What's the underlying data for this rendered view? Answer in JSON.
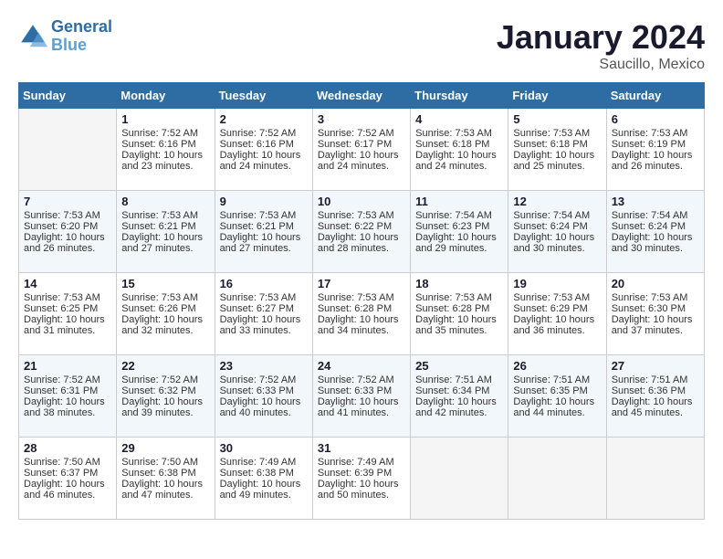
{
  "header": {
    "logo_line1": "General",
    "logo_line2": "Blue",
    "month": "January 2024",
    "location": "Saucillo, Mexico"
  },
  "days_of_week": [
    "Sunday",
    "Monday",
    "Tuesday",
    "Wednesday",
    "Thursday",
    "Friday",
    "Saturday"
  ],
  "weeks": [
    [
      {
        "day": "",
        "empty": true
      },
      {
        "day": "1",
        "sunrise": "7:52 AM",
        "sunset": "6:16 PM",
        "daylight": "10 hours and 23 minutes."
      },
      {
        "day": "2",
        "sunrise": "7:52 AM",
        "sunset": "6:16 PM",
        "daylight": "10 hours and 24 minutes."
      },
      {
        "day": "3",
        "sunrise": "7:52 AM",
        "sunset": "6:17 PM",
        "daylight": "10 hours and 24 minutes."
      },
      {
        "day": "4",
        "sunrise": "7:53 AM",
        "sunset": "6:18 PM",
        "daylight": "10 hours and 24 minutes."
      },
      {
        "day": "5",
        "sunrise": "7:53 AM",
        "sunset": "6:18 PM",
        "daylight": "10 hours and 25 minutes."
      },
      {
        "day": "6",
        "sunrise": "7:53 AM",
        "sunset": "6:19 PM",
        "daylight": "10 hours and 26 minutes."
      }
    ],
    [
      {
        "day": "7",
        "sunrise": "7:53 AM",
        "sunset": "6:20 PM",
        "daylight": "10 hours and 26 minutes."
      },
      {
        "day": "8",
        "sunrise": "7:53 AM",
        "sunset": "6:21 PM",
        "daylight": "10 hours and 27 minutes."
      },
      {
        "day": "9",
        "sunrise": "7:53 AM",
        "sunset": "6:21 PM",
        "daylight": "10 hours and 27 minutes."
      },
      {
        "day": "10",
        "sunrise": "7:53 AM",
        "sunset": "6:22 PM",
        "daylight": "10 hours and 28 minutes."
      },
      {
        "day": "11",
        "sunrise": "7:54 AM",
        "sunset": "6:23 PM",
        "daylight": "10 hours and 29 minutes."
      },
      {
        "day": "12",
        "sunrise": "7:54 AM",
        "sunset": "6:24 PM",
        "daylight": "10 hours and 30 minutes."
      },
      {
        "day": "13",
        "sunrise": "7:54 AM",
        "sunset": "6:24 PM",
        "daylight": "10 hours and 30 minutes."
      }
    ],
    [
      {
        "day": "14",
        "sunrise": "7:53 AM",
        "sunset": "6:25 PM",
        "daylight": "10 hours and 31 minutes."
      },
      {
        "day": "15",
        "sunrise": "7:53 AM",
        "sunset": "6:26 PM",
        "daylight": "10 hours and 32 minutes."
      },
      {
        "day": "16",
        "sunrise": "7:53 AM",
        "sunset": "6:27 PM",
        "daylight": "10 hours and 33 minutes."
      },
      {
        "day": "17",
        "sunrise": "7:53 AM",
        "sunset": "6:28 PM",
        "daylight": "10 hours and 34 minutes."
      },
      {
        "day": "18",
        "sunrise": "7:53 AM",
        "sunset": "6:28 PM",
        "daylight": "10 hours and 35 minutes."
      },
      {
        "day": "19",
        "sunrise": "7:53 AM",
        "sunset": "6:29 PM",
        "daylight": "10 hours and 36 minutes."
      },
      {
        "day": "20",
        "sunrise": "7:53 AM",
        "sunset": "6:30 PM",
        "daylight": "10 hours and 37 minutes."
      }
    ],
    [
      {
        "day": "21",
        "sunrise": "7:52 AM",
        "sunset": "6:31 PM",
        "daylight": "10 hours and 38 minutes."
      },
      {
        "day": "22",
        "sunrise": "7:52 AM",
        "sunset": "6:32 PM",
        "daylight": "10 hours and 39 minutes."
      },
      {
        "day": "23",
        "sunrise": "7:52 AM",
        "sunset": "6:33 PM",
        "daylight": "10 hours and 40 minutes."
      },
      {
        "day": "24",
        "sunrise": "7:52 AM",
        "sunset": "6:33 PM",
        "daylight": "10 hours and 41 minutes."
      },
      {
        "day": "25",
        "sunrise": "7:51 AM",
        "sunset": "6:34 PM",
        "daylight": "10 hours and 42 minutes."
      },
      {
        "day": "26",
        "sunrise": "7:51 AM",
        "sunset": "6:35 PM",
        "daylight": "10 hours and 44 minutes."
      },
      {
        "day": "27",
        "sunrise": "7:51 AM",
        "sunset": "6:36 PM",
        "daylight": "10 hours and 45 minutes."
      }
    ],
    [
      {
        "day": "28",
        "sunrise": "7:50 AM",
        "sunset": "6:37 PM",
        "daylight": "10 hours and 46 minutes."
      },
      {
        "day": "29",
        "sunrise": "7:50 AM",
        "sunset": "6:38 PM",
        "daylight": "10 hours and 47 minutes."
      },
      {
        "day": "30",
        "sunrise": "7:49 AM",
        "sunset": "6:38 PM",
        "daylight": "10 hours and 49 minutes."
      },
      {
        "day": "31",
        "sunrise": "7:49 AM",
        "sunset": "6:39 PM",
        "daylight": "10 hours and 50 minutes."
      },
      {
        "day": "",
        "empty": true
      },
      {
        "day": "",
        "empty": true
      },
      {
        "day": "",
        "empty": true
      }
    ]
  ]
}
